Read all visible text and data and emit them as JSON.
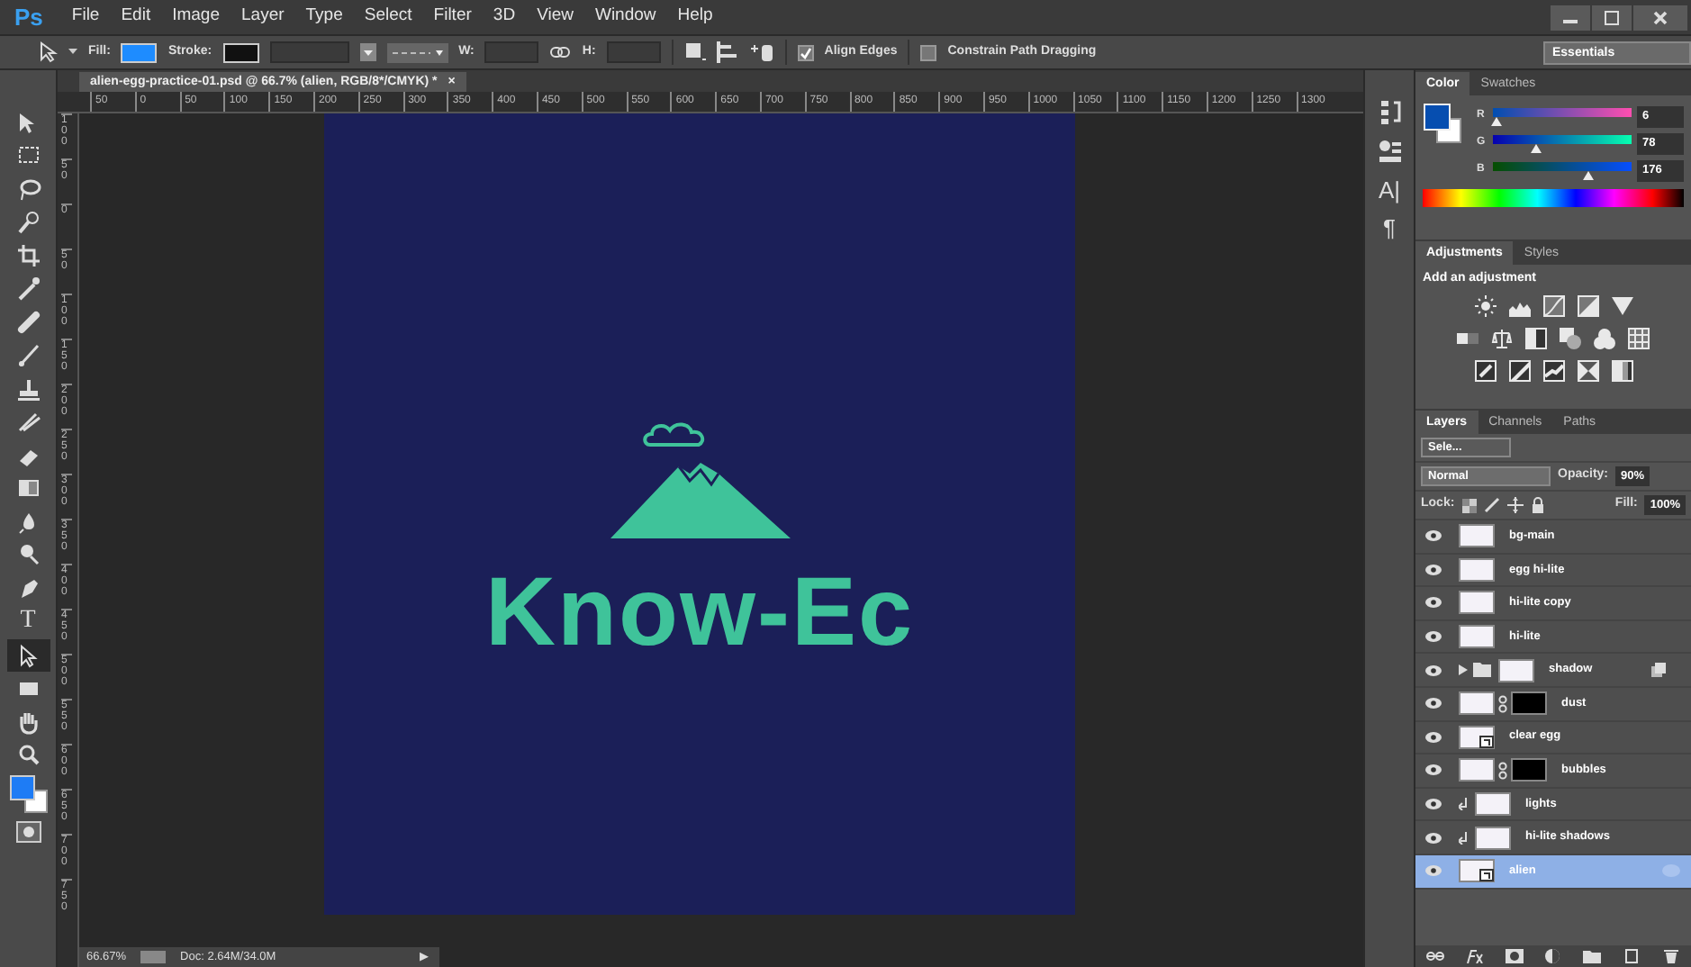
{
  "menu": {
    "logo": "Ps",
    "items": [
      "File",
      "Edit",
      "Image",
      "Layer",
      "Type",
      "Select",
      "Filter",
      "3D",
      "View",
      "Window",
      "Help"
    ]
  },
  "options_bar": {
    "fill_label": "Fill:",
    "stroke_label": "Stroke:",
    "width_label": "W:",
    "height_label": "H:",
    "align_edges": {
      "label": "Align Edges",
      "checked": true
    },
    "constrain": {
      "label": "Constrain Path Dragging",
      "checked": false
    },
    "workspace": "Essentials"
  },
  "tools": [
    {
      "selected": false
    },
    {
      "selected": false
    },
    {
      "selected": false
    },
    {
      "selected": false
    },
    {
      "selected": false
    },
    {
      "selected": false
    },
    {
      "selected": false
    },
    {
      "selected": false
    },
    {
      "selected": false
    },
    {
      "selected": false
    },
    {
      "selected": false
    },
    {
      "selected": false
    },
    {
      "selected": false
    },
    {
      "selected": false
    },
    {
      "selected": false
    },
    {
      "selected": false,
      "glyph": "T"
    },
    {
      "selected": true
    },
    {
      "selected": false
    },
    {
      "selected": false
    },
    {
      "selected": false
    }
  ],
  "document": {
    "tab_title": "alien-egg-practice-01.psd @ 66.7% (alien, RGB/8*/CMYK) *",
    "close": "×",
    "ruler_h": [
      "50",
      "0",
      "50",
      "100",
      "150",
      "200",
      "250",
      "300",
      "350",
      "400",
      "450",
      "500",
      "550",
      "600",
      "650",
      "700",
      "750",
      "800",
      "850",
      "900",
      "950",
      "1000",
      "1050",
      "1100",
      "1150",
      "1200",
      "1250",
      "1300"
    ],
    "ruler_v": [
      "100",
      "50",
      "0",
      "50",
      "100",
      "150",
      "200",
      "250",
      "300",
      "350",
      "400",
      "450",
      "500",
      "550",
      "600",
      "650",
      "700",
      "750"
    ],
    "logo_text": "Know-Ec"
  },
  "status_bar": {
    "zoom": "66.67%",
    "doc_size": "Doc: 2.64M/34.0M",
    "arrow": "▶"
  },
  "dock_glyphs": [
    "A|",
    "¶"
  ],
  "color_panel": {
    "tabs": [
      {
        "label": "Color",
        "selected": true
      },
      {
        "label": "Swatches",
        "selected": false
      }
    ],
    "channels": [
      {
        "label": "R",
        "value": "6",
        "level": 0.02
      },
      {
        "label": "G",
        "value": "78",
        "level": 0.31
      },
      {
        "label": "B",
        "value": "176",
        "level": 0.69
      }
    ]
  },
  "adjustments_panel": {
    "tabs": [
      {
        "label": "Adjustments",
        "selected": true
      },
      {
        "label": "Styles",
        "selected": false
      }
    ],
    "heading": "Add an adjustment"
  },
  "layers_panel": {
    "tabs": [
      {
        "label": "Layers",
        "selected": true
      },
      {
        "label": "Channels",
        "selected": false
      },
      {
        "label": "Paths",
        "selected": false
      }
    ],
    "filter": "Sele...",
    "blend_mode": "Normal",
    "opacity_label": "Opacity:",
    "opacity": "90%",
    "lock_label": "Lock:",
    "fill_label": "Fill:",
    "fill": "100%",
    "layers": [
      {
        "name": "bg-main",
        "kind": "normal",
        "visible": true,
        "selected": false
      },
      {
        "name": "egg hi-lite",
        "kind": "normal",
        "visible": true,
        "selected": false
      },
      {
        "name": "hi-lite copy",
        "kind": "normal",
        "visible": true,
        "selected": false
      },
      {
        "name": "hi-lite",
        "kind": "normal",
        "visible": true,
        "selected": false
      },
      {
        "name": "shadow",
        "kind": "group",
        "visible": true,
        "selected": false
      },
      {
        "name": "dust",
        "kind": "masked",
        "visible": true,
        "selected": false
      },
      {
        "name": "clear egg",
        "kind": "smart",
        "visible": true,
        "selected": false
      },
      {
        "name": "bubbles",
        "kind": "masked",
        "visible": true,
        "selected": false
      },
      {
        "name": "lights",
        "kind": "clipped",
        "visible": true,
        "selected": false
      },
      {
        "name": "hi-lite shadows",
        "kind": "clipped",
        "visible": true,
        "selected": false
      },
      {
        "name": "alien",
        "kind": "smart",
        "visible": true,
        "selected": true
      }
    ]
  }
}
